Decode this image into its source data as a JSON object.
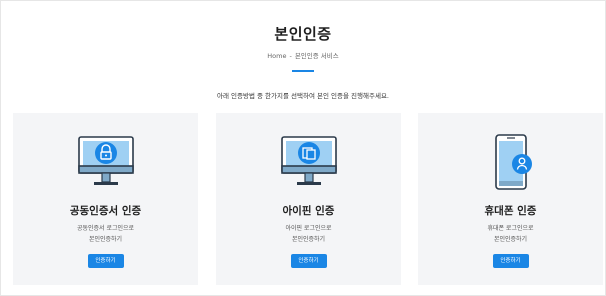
{
  "header": {
    "title": "본인인증",
    "breadcrumb": [
      "Home",
      "본인인증 서비스"
    ],
    "breadcrumb_separator": "-"
  },
  "intro_text": "아래 인증방법 중 한가지를 선택하여 본인 인증을 진행해주세요.",
  "colors": {
    "accent": "#1a86e5",
    "card_bg": "#f4f5f7",
    "monitor_screen": "#9fd0f3"
  },
  "cards": [
    {
      "title": "공동인증서 인증",
      "desc_line1": "공동인증서 로그인으로",
      "desc_line2": "본인인증하기",
      "button_label": "인증하기",
      "icon": "certificate-lock-monitor-icon"
    },
    {
      "title": "아이핀 인증",
      "desc_line1": "아이핀 로그인으로",
      "desc_line2": "본인인증하기",
      "button_label": "인증하기",
      "icon": "ipin-id-monitor-icon"
    },
    {
      "title": "휴대폰 인증",
      "desc_line1": "휴대폰 로그인으로",
      "desc_line2": "본인인증하기",
      "button_label": "인증하기",
      "icon": "mobile-phone-user-icon"
    }
  ]
}
